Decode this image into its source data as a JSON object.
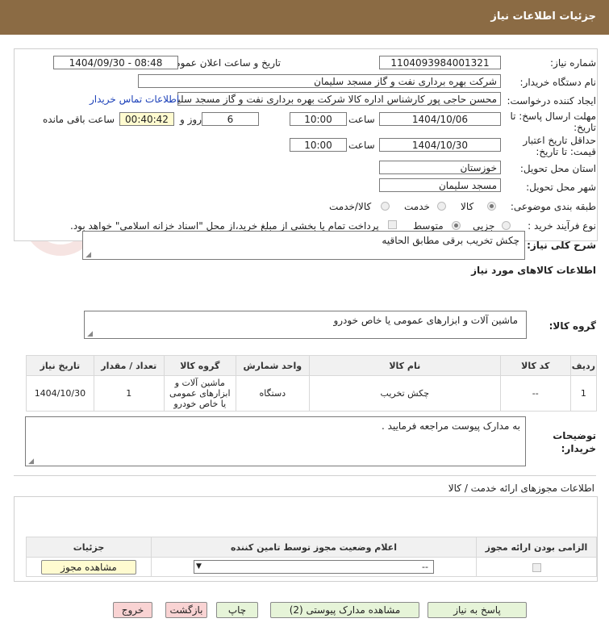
{
  "header": {
    "title": "جزئیات اطلاعات نیاز"
  },
  "form": {
    "need_number_label": "شماره نیاز:",
    "need_number": "1104093984001321",
    "announce_label": "تاریخ و ساعت اعلان عمومی:",
    "announce_value": "1404/09/30 - 08:48",
    "buyer_org_label": "نام دستگاه خریدار:",
    "buyer_org": "شرکت بهره برداری نفت و گاز مسجد سلیمان",
    "requester_label": "ایجاد کننده درخواست:",
    "requester": "محسن حاجی پور کارشناس اداره کالا  شرکت بهره برداری نفت و گاز مسجد سلیمان",
    "contact_link": "اطلاعات تماس خریدار",
    "reply_deadline_label_1": "مهلت ارسال پاسخ: تا",
    "reply_deadline_label_2": "تاریخ:",
    "reply_date": "1404/10/06",
    "time_label": "ساعت",
    "reply_time": "10:00",
    "days_value": "6",
    "days_label": "روز و",
    "remaining_value": "00:40:42",
    "remaining_label": "ساعت باقی مانده",
    "validity_label_1": "حداقل تاریخ اعتبار",
    "validity_label_2": "قیمت: تا تاریخ:",
    "validity_date": "1404/10/30",
    "validity_time": "10:00",
    "province_label": "استان محل تحویل:",
    "province": "خوزستان",
    "city_label": "شهر محل تحویل:",
    "city": "مسجد سلیمان",
    "category_label": "طبقه بندی موضوعی:",
    "category_options": [
      "کالا",
      "خدمت",
      "کالا/خدمت"
    ],
    "process_label": "نوع فرآیند خرید :",
    "process_options": [
      "جزیی",
      "متوسط"
    ],
    "payment_note": "پرداخت تمام یا بخشی از مبلغ خرید،از محل \"اسناد خزانه اسلامی\" خواهد بود."
  },
  "summary": {
    "label": "شرح کلی نیاز:",
    "value": "چکش تخریب برقی مطابق الحاقیه"
  },
  "goods_info": {
    "title": "اطلاعات کالاهای مورد نیاز",
    "group_label": "گروه کالا:",
    "group_value": "ماشین آلات و ابزارهای عمومی یا خاص خودرو"
  },
  "items_table": {
    "headers": [
      "ردیف",
      "کد کالا",
      "نام کالا",
      "واحد شمارش",
      "گروه کالا",
      "تعداد / مقدار",
      "تاریخ نیاز"
    ],
    "rows": [
      [
        "1",
        "--",
        "چکش تخریب",
        "دستگاه",
        "ماشین آلات و ابزارهای عمومی یا خاص خودرو",
        "1",
        "1404/10/30"
      ]
    ]
  },
  "buyer_notes": {
    "label_1": "توضیحات",
    "label_2": "خریدار:",
    "value": "به مدارک پیوست مراجعه فرمایید ."
  },
  "permits": {
    "title": "اطلاعات مجوزهای ارائه خدمت / کالا",
    "headers": [
      "الزامی بودن ارائه مجوز",
      "اعلام وضعیت مجوز توسط تامین کننده",
      "جزئیات"
    ],
    "select_value": "--",
    "view_button": "مشاهده مجوز"
  },
  "buttons": {
    "reply": "پاسخ به نیاز",
    "attachments": "مشاهده مدارک پیوستی (2)",
    "print": "چاپ",
    "back": "بازگشت",
    "exit": "خروج"
  },
  "watermark": {
    "text": "AriaTender.neT"
  },
  "colors": {
    "header": "#8b6b44",
    "highlight": "#fffbd0",
    "link": "#1a3fb8",
    "green_button": "#e6f4d8",
    "pink_button": "#f9d3d3"
  }
}
